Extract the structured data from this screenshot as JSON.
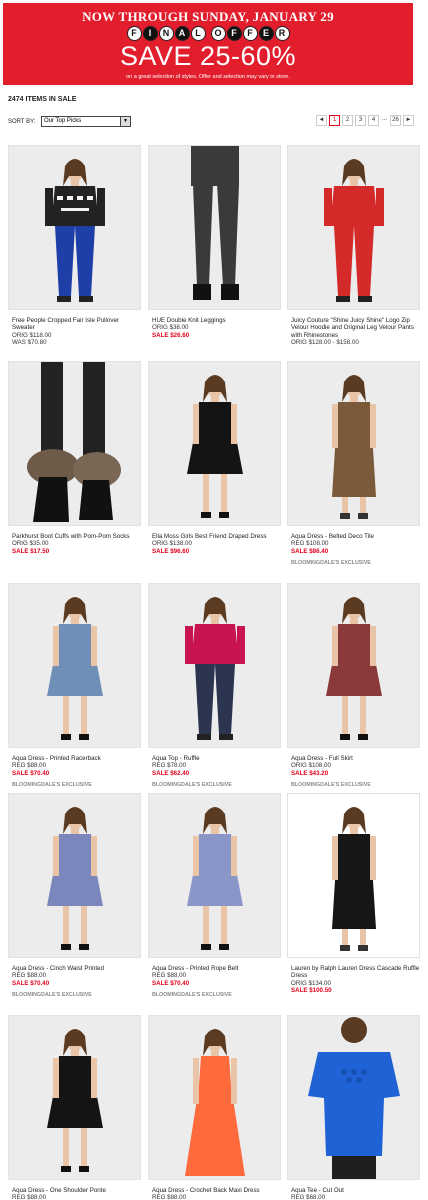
{
  "banner": {
    "headline": "NOW THROUGH SUNDAY, JANUARY 29",
    "offer_letters": [
      "F",
      "I",
      "N",
      "A",
      "L",
      "O",
      "F",
      "F",
      "E",
      "R"
    ],
    "save": "SAVE 25-60%",
    "subtext": "on a great selection of styles. Offer and selection may vary in store.",
    "color": "#e21d2c"
  },
  "items_count": "2474 ITEMS IN SALE",
  "sort": {
    "label": "SORT BY:",
    "selected": "Our Top Picks"
  },
  "pagination": {
    "prev": "◄",
    "pages": [
      "1",
      "2",
      "3",
      "4"
    ],
    "ellipsis": "...",
    "last": "26",
    "next": "►",
    "current": "1"
  },
  "products": [
    {
      "name": "Free People Cropped Fair Isle Pullover Sweater",
      "prices": [
        "ORIG $118.00",
        "WAS $70.80"
      ],
      "sale": "",
      "exclusive": ""
    },
    {
      "name": "HUE Double Knit Leggings",
      "prices": [
        "ORIG $38.00"
      ],
      "sale": "SALE $26.60",
      "exclusive": ""
    },
    {
      "name": "Juicy Couture \"Shine Juicy Shine\" Logo Zip Velour Hoodie and Original Leg Velour Pants with Rhinestones",
      "prices": [
        "ORIG $128.00 - $158.00"
      ],
      "sale": "",
      "exclusive": ""
    },
    {
      "name": "Parkhurst Boot Cuffs with Pom-Pom Socks",
      "prices": [
        "ORIG $35.00"
      ],
      "sale": "SALE $17.50",
      "exclusive": ""
    },
    {
      "name": "Ella Moss Girls Best Friend Draped Dress",
      "prices": [
        "ORIG $138.00"
      ],
      "sale": "SALE $96.60",
      "exclusive": ""
    },
    {
      "name": "Aqua Dress - Belted Deco Tile",
      "prices": [
        "REG $108.00"
      ],
      "sale": "SALE $86.40",
      "exclusive": "BLOOMINGDALE'S EXCLUSIVE"
    },
    {
      "name": "Aqua Dress - Printed Racerback",
      "prices": [
        "REG $88.00"
      ],
      "sale": "SALE $70.40",
      "exclusive": "BLOOMINGDALE'S EXCLUSIVE"
    },
    {
      "name": "Aqua Top - Ruffle",
      "prices": [
        "REG $78.00"
      ],
      "sale": "SALE $62.40",
      "exclusive": "BLOOMINGDALE'S EXCLUSIVE"
    },
    {
      "name": "Aqua Dress - Full Skirt",
      "prices": [
        "ORIG $108.00"
      ],
      "sale": "SALE $43.20",
      "exclusive": "BLOOMINGDALE'S EXCLUSIVE"
    },
    {
      "name": "Aqua Dress - Cinch Waist Printed",
      "prices": [
        "REG $88.00"
      ],
      "sale": "SALE $70.40",
      "exclusive": "BLOOMINGDALE'S EXCLUSIVE"
    },
    {
      "name": "Aqua Dress - Printed Rope Belt",
      "prices": [
        "REG $88.00"
      ],
      "sale": "SALE $70.40",
      "exclusive": "BLOOMINGDALE'S EXCLUSIVE"
    },
    {
      "name": "Lauren by Ralph Lauren Dress Cascade Ruffle Dress",
      "prices": [
        "ORIG $134.00"
      ],
      "sale": "SALE $100.50",
      "exclusive": ""
    },
    {
      "name": "Aqua Dress - One Shoulder Ponte",
      "prices": [
        "REG $88.00"
      ],
      "sale": "",
      "exclusive": ""
    },
    {
      "name": "Aqua Dress - Crochet Back Maxi Dress",
      "prices": [
        "REG $88.00"
      ],
      "sale": "",
      "exclusive": ""
    },
    {
      "name": "Aqua Tee - Cut Out",
      "prices": [
        "REG $68.00"
      ],
      "sale": "",
      "exclusive": ""
    }
  ]
}
